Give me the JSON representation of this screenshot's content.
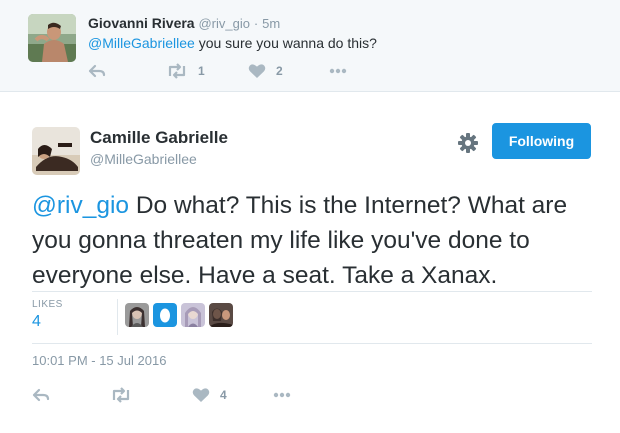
{
  "reply_tweet": {
    "fullname": "Giovanni Rivera",
    "username": "@riv_gio",
    "separator": "·",
    "time": "5m",
    "mention": "@MilleGabriellee",
    "text": " you sure you wanna do this?",
    "actions": {
      "reply_icon": "reply-icon",
      "retweet_icon": "retweet-icon",
      "retweet_count": "1",
      "like_icon": "heart-icon",
      "like_count": "2",
      "more_icon": "more-icon"
    }
  },
  "main_tweet": {
    "fullname": "Camille Gabrielle",
    "username": "@MilleGabriellee",
    "settings_icon": "gear-icon",
    "follow_button_label": "Following",
    "mention": "@riv_gio",
    "text": " Do what? This is the Internet? What are you gonna threaten my life like you've done to everyone else. Have a seat. Take a Xanax.",
    "likes_label": "LIKES",
    "likes_count": "4",
    "timestamp": "10:01 PM - 15 Jul 2016",
    "actions": {
      "reply_icon": "reply-icon",
      "retweet_icon": "retweet-icon",
      "like_icon": "heart-icon",
      "like_count": "4",
      "more_icon": "more-icon"
    }
  },
  "colors": {
    "accent": "#1b95e0",
    "text": "#292f33",
    "muted": "#8899a6",
    "reply_bg": "#f5f8fa",
    "divider": "#e1e8ed"
  }
}
